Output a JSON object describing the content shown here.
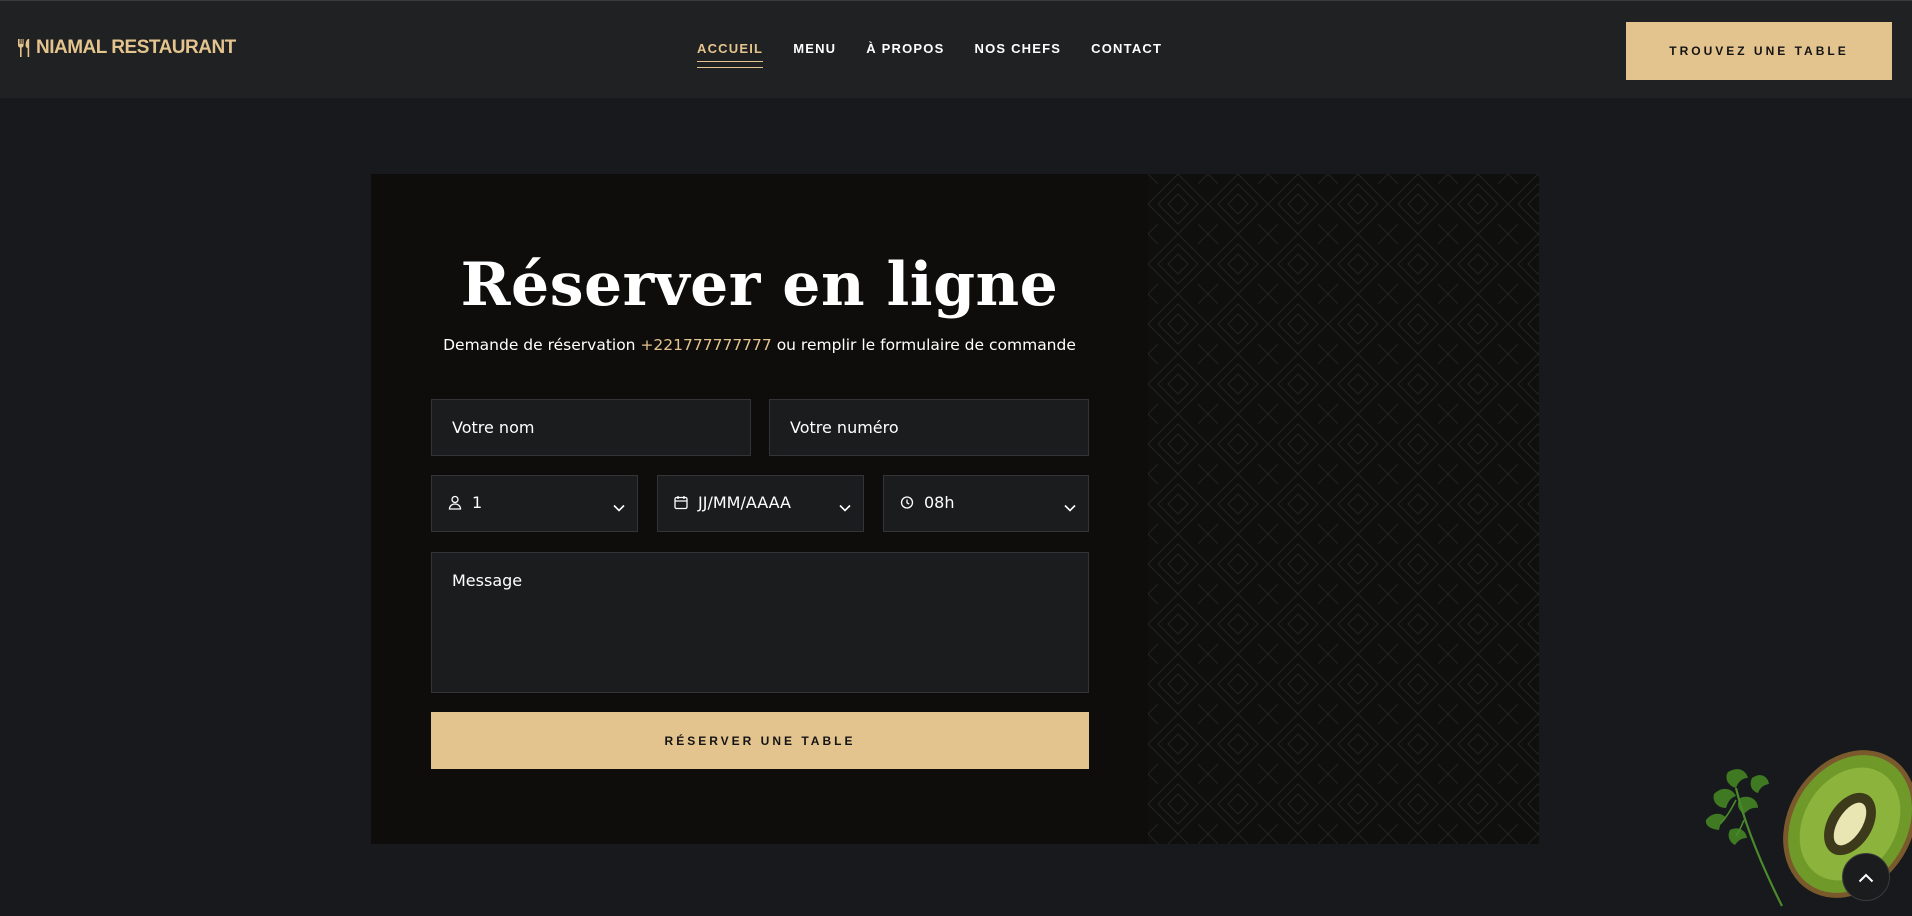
{
  "header": {
    "logo_text": "NIAMAL RESTAURANT",
    "nav": [
      {
        "label": "ACCUEIL",
        "active": true
      },
      {
        "label": "MENU",
        "active": false
      },
      {
        "label": "À PROPOS",
        "active": false
      },
      {
        "label": "NOS CHEFS",
        "active": false
      },
      {
        "label": "CONTACT",
        "active": false
      }
    ],
    "cta_label": "TROUVEZ UNE TABLE"
  },
  "reservation": {
    "title": "Réserver en ligne",
    "subtitle_before": "Demande de réservation ",
    "phone": "+221777777777",
    "subtitle_after": " ou remplir le formulaire de commande",
    "name_placeholder": "Votre nom",
    "phone_placeholder": "Votre numéro",
    "guests": {
      "value": "1",
      "icon": "user-icon"
    },
    "date": {
      "value": "JJ/MM/AAAA",
      "icon": "calendar-icon"
    },
    "time": {
      "value": "08h",
      "icon": "clock-icon"
    },
    "message_placeholder": "Message",
    "submit_label": "RÉSERVER UNE TABLE"
  },
  "colors": {
    "accent": "#e4c48e",
    "background": "#17191c",
    "header": "#202122",
    "card": "#0e0d0c",
    "field": "#1b1c1e"
  },
  "decorations": {
    "image": "kiwi-and-parsley",
    "scroll_icon": "chevron-up-icon"
  }
}
